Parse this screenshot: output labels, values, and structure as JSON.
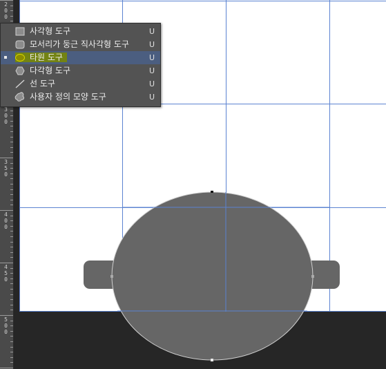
{
  "ruler": {
    "groups": [
      {
        "digits": [
          "2",
          "0",
          "0"
        ]
      },
      {
        "digits": [
          "3",
          "0",
          "0"
        ]
      },
      {
        "digits": [
          "3",
          "5",
          "0"
        ]
      },
      {
        "digits": [
          "4",
          "0",
          "0"
        ]
      },
      {
        "digits": [
          "4",
          "5",
          "0"
        ]
      },
      {
        "digits": [
          "5",
          "0",
          "0"
        ]
      }
    ]
  },
  "menu": {
    "items": [
      {
        "label": "사각형 도구",
        "shortcut": "U",
        "icon": "rectangle-icon",
        "selected": false
      },
      {
        "label": "모서리가 둥근 직사각형 도구",
        "shortcut": "U",
        "icon": "rounded-rectangle-icon",
        "selected": false
      },
      {
        "label": "타원 도구",
        "shortcut": "U",
        "icon": "ellipse-icon",
        "selected": true
      },
      {
        "label": "다각형 도구",
        "shortcut": "U",
        "icon": "polygon-icon",
        "selected": false
      },
      {
        "label": "선 도구",
        "shortcut": "U",
        "icon": "line-icon",
        "selected": false
      },
      {
        "label": "사용자 정의 모양 도구",
        "shortcut": "U",
        "icon": "custom-shape-icon",
        "selected": false
      }
    ]
  },
  "colors": {
    "shape_fill": "#666666",
    "guide": "#5b83d1",
    "menu_bg": "#535353",
    "menu_selected": "#4b5e80",
    "highlight": "#7a8a00"
  }
}
